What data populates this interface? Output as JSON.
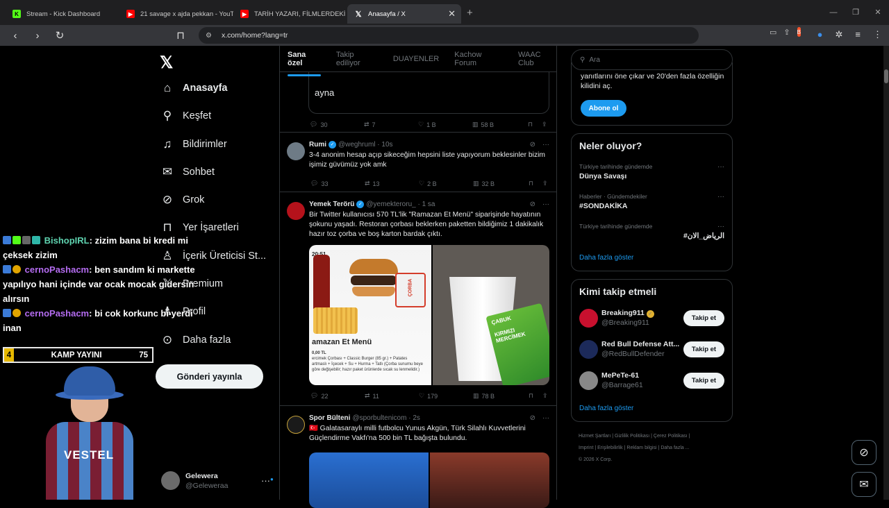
{
  "browser": {
    "tabs": [
      {
        "title": "Stream - Kick Dashboard",
        "icon": "kick-icon",
        "color": "#53fc18"
      },
      {
        "title": "21 savage x ajda pekkan - YouTube",
        "icon": "youtube-icon",
        "color": "#ff0000"
      },
      {
        "title": "TARİH YAZARI, FİLMLERDEKİ HİTLER",
        "icon": "youtube-icon",
        "color": "#ff0000"
      },
      {
        "title": "Anasayfa / X",
        "icon": "x-icon",
        "color": "#ffffff"
      }
    ],
    "new_tab": "+",
    "url": "x.com/home?lang=tr"
  },
  "sidebar": {
    "items": [
      {
        "label": "Anasayfa",
        "icon": "home-icon",
        "glyph": "⌂"
      },
      {
        "label": "Keşfet",
        "icon": "search-icon",
        "glyph": "⚲"
      },
      {
        "label": "Bildirimler",
        "icon": "bell-icon",
        "glyph": "🔔"
      },
      {
        "label": "Sohbet",
        "icon": "mail-icon",
        "glyph": "✉"
      },
      {
        "label": "Grok",
        "icon": "grok-icon",
        "glyph": "⊘"
      },
      {
        "label": "Yer İşaretleri",
        "icon": "bookmark-icon",
        "glyph": "🔖"
      },
      {
        "label": "İçerik Üreticisi St...",
        "icon": "creator-icon",
        "glyph": "♙"
      },
      {
        "label": "Premium",
        "icon": "x-premium-icon",
        "glyph": "X"
      },
      {
        "label": "Profil",
        "icon": "profile-icon",
        "glyph": "♟"
      },
      {
        "label": "Daha fazla",
        "icon": "more-circle-icon",
        "glyph": "⊙"
      }
    ],
    "post_button": "Gönderi yayınla",
    "account": {
      "name": "Gelewera",
      "handle": "@Geleweraa"
    }
  },
  "feed": {
    "tabs": [
      "Sana özel",
      "Takip ediliyor",
      "DUAYENLER",
      "Kachow Forum",
      "WAAC Club"
    ],
    "quote_text": "ayna",
    "quote_stats": {
      "replies": "30",
      "reposts": "7",
      "likes": "1 B",
      "views": "58 B"
    },
    "tweets": [
      {
        "name": "Rumi",
        "handle": "@weghruml",
        "time": "10s",
        "text": "3-4 anonim hesap açıp sikeceğim hepsini liste yapıyorum beklesinler bizim işimiz güvümüz yok amk",
        "replies": "33",
        "reposts": "13",
        "likes": "2 B",
        "views": "32 B"
      },
      {
        "name": "Yemek Terörü",
        "handle": "@yemekteroru_",
        "time": "1 sa",
        "text": "Bir Twitter kullanıcısı 570 TL'lik \"Ramazan Et Menü\" siparişinde hayatının şokunu yaşadı. Restoran çorbası beklerken paketten bildiğimiz 1 dakikalık hazır toz çorba ve boş karton bardak çıktı.",
        "replies": "22",
        "reposts": "11",
        "likes": "179",
        "views": "78 B",
        "image_left": {
          "time": "20:51",
          "menu_title": "amazan Et Menü",
          "price": "0,00 TL",
          "small": "ercimek Çorbası + Classic Burger (85 gr.) + Patates artmaslı + İçecek + Su + Hurma + Tatlı (Çorba sunumu beye göre değişebilir; hazır paket ürünlerde sıcak su lenmelidir.)",
          "corba": "ÇORBA"
        },
        "image_right": {
          "pack": "ÇABUK",
          "pack2": "KIRMIZI MERCİMEK"
        }
      },
      {
        "name": "Spor Bülteni",
        "handle": "@sporbultenicom",
        "time": "2s",
        "text": "🇹🇷 Galatasaraylı milli futbolcu Yunus Akgün, Türk Silahlı Kuvvetlerini Güçlendirme Vakfı'na 500 bin TL bağışta bulundu."
      }
    ]
  },
  "right": {
    "search_placeholder": "Ara",
    "premium_text": "yanıtlarını öne çıkar ve 20'den fazla özelliğin kilidini aç.",
    "subscribe": "Abone ol",
    "trends_title": "Neler oluyor?",
    "trends": [
      {
        "cat": "Türkiye tarihinde gündemde",
        "name": "Dünya Savaşı"
      },
      {
        "cat": "Haberler · Gündemdekiler",
        "name": "#SONDAKİKA"
      },
      {
        "cat": "Türkiye tarihinde gündemde",
        "name": "#الرياض_الان"
      }
    ],
    "show_more": "Daha fazla göster",
    "who_title": "Kimi takip etmeli",
    "who": [
      {
        "name": "Breaking911",
        "handle": "@Breaking911",
        "color": "#c8102e"
      },
      {
        "name": "Red Bull Defense Att...",
        "handle": "@RedBullDefender",
        "color": "#1c2a5a"
      },
      {
        "name": "MePeTe-61",
        "handle": "@Barrage61",
        "color": "#888888"
      }
    ],
    "follow": "Takip et",
    "footer": [
      "Hizmet Şartları",
      "Gizlilik Politikası",
      "Çerez Politikası",
      "Imprint",
      "Erişilebilirlik",
      "Reklam bilgisi",
      "Daha fazla ...",
      "© 2026 X Corp."
    ]
  },
  "overlay": {
    "chat": [
      {
        "user": "BishopIRL",
        "msg": ": zizim bana bi kredi mi çeksek zizim"
      },
      {
        "user": "cernoPashacm",
        "msg": ": ben sandım ki markette yapılıyo hani içinde var ocak mocak gidersin alırsın"
      },
      {
        "user": "cernoPashacm",
        "msg": ": bi cok korkunc bi yerdi inan"
      }
    ],
    "kamp_left": "4",
    "kamp_title": "KAMP YAYINI",
    "kamp_right": "75",
    "shirt_text": "VESTEL"
  }
}
